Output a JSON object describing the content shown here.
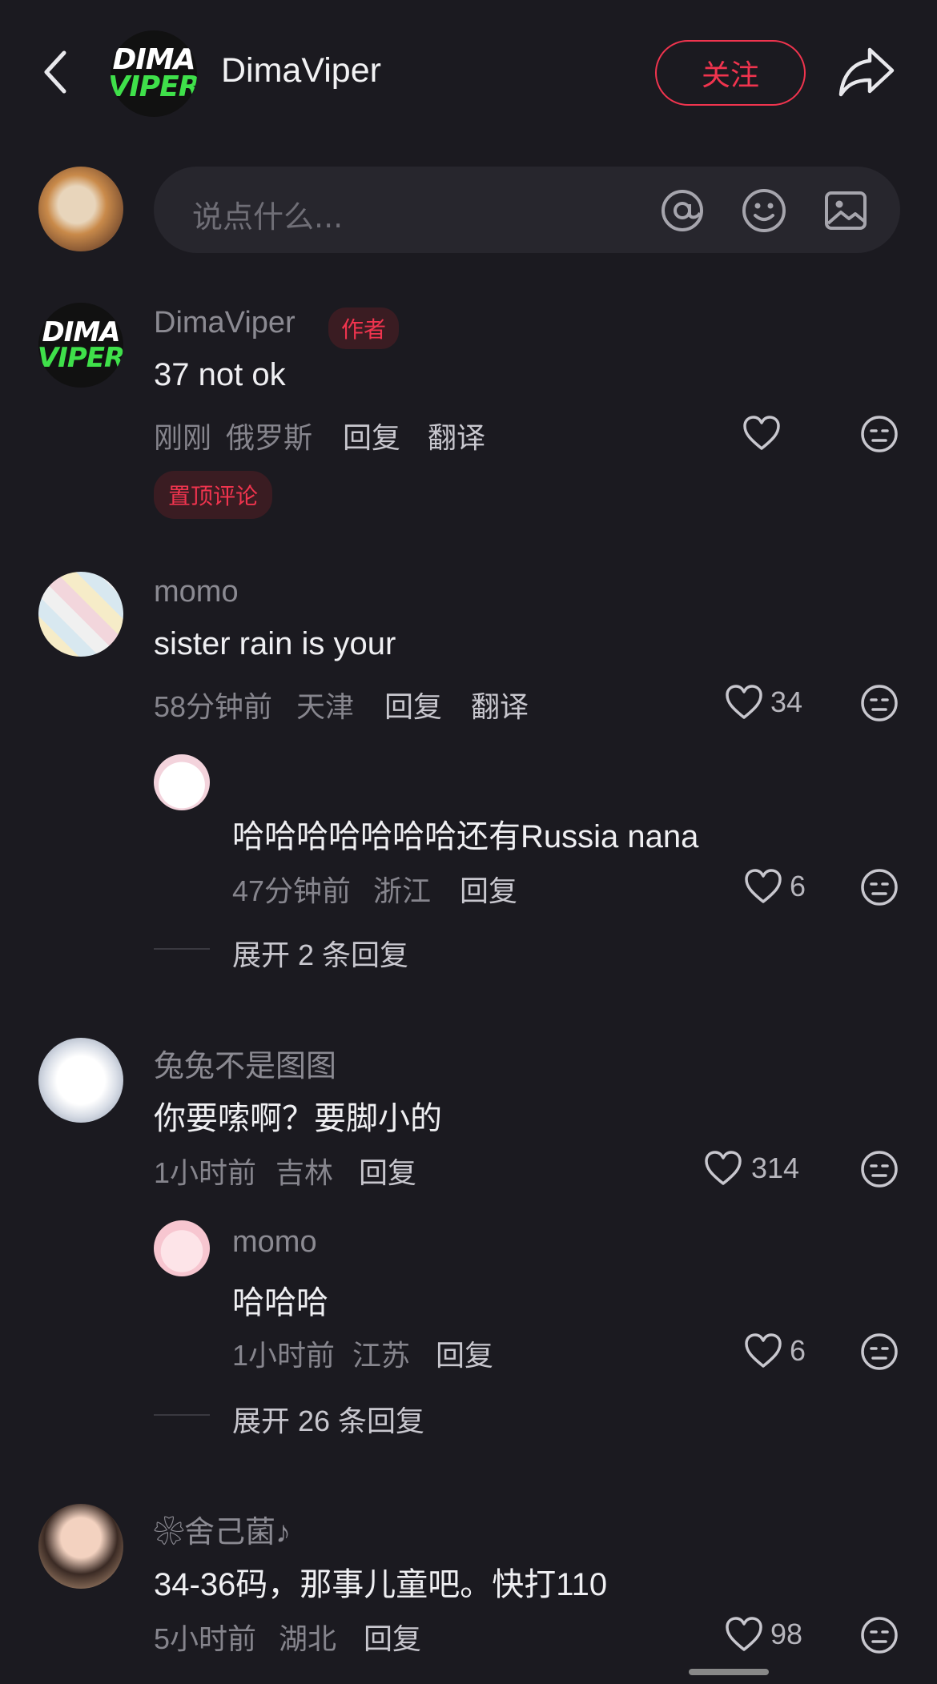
{
  "header": {
    "name": "DimaViper",
    "follow_label": "关注",
    "logo_top": "DIMA",
    "logo_bottom": "VIPER"
  },
  "input": {
    "placeholder": "说点什么..."
  },
  "comments": [
    {
      "user": "DimaViper",
      "author_tag": "作者",
      "text": "37 not ok",
      "time": "刚刚",
      "location": "俄罗斯",
      "reply": "回复",
      "translate": "翻译",
      "pinned": "置顶评论",
      "likes": ""
    },
    {
      "user": "momo",
      "text": "sister rain is your",
      "time": "58分钟前",
      "location": "天津",
      "reply": "回复",
      "translate": "翻译",
      "likes": "34",
      "subreply": {
        "text": "哈哈哈哈哈哈哈还有Russia nana",
        "time": "47分钟前",
        "location": "浙江",
        "reply": "回复",
        "likes": "6"
      },
      "expand": "展开 2 条回复"
    },
    {
      "user": "兔兔不是图图",
      "text": "你要嗦啊？要脚小的",
      "time": "1小时前",
      "location": "吉林",
      "reply": "回复",
      "likes": "314",
      "subreply": {
        "user": "momo",
        "text": "哈哈哈",
        "time": "1小时前",
        "location": "江苏",
        "reply": "回复",
        "likes": "6"
      },
      "expand": "展开 26 条回复"
    },
    {
      "user": "❀舍己菌♪",
      "text": "34-36码，那事儿童吧。快打110",
      "time": "5小时前",
      "location": "湖北",
      "reply": "回复",
      "likes": "98"
    }
  ],
  "icons": {
    "back": "chevron-left-icon",
    "share": "share-arrow-icon",
    "at": "at-icon",
    "emoji": "emoji-icon",
    "image": "image-icon",
    "like": "heart-icon",
    "dislike": "meh-face-icon"
  },
  "colors": {
    "background": "#1b1a20",
    "accent": "#f0344e",
    "logo_green": "#3fe04a"
  }
}
